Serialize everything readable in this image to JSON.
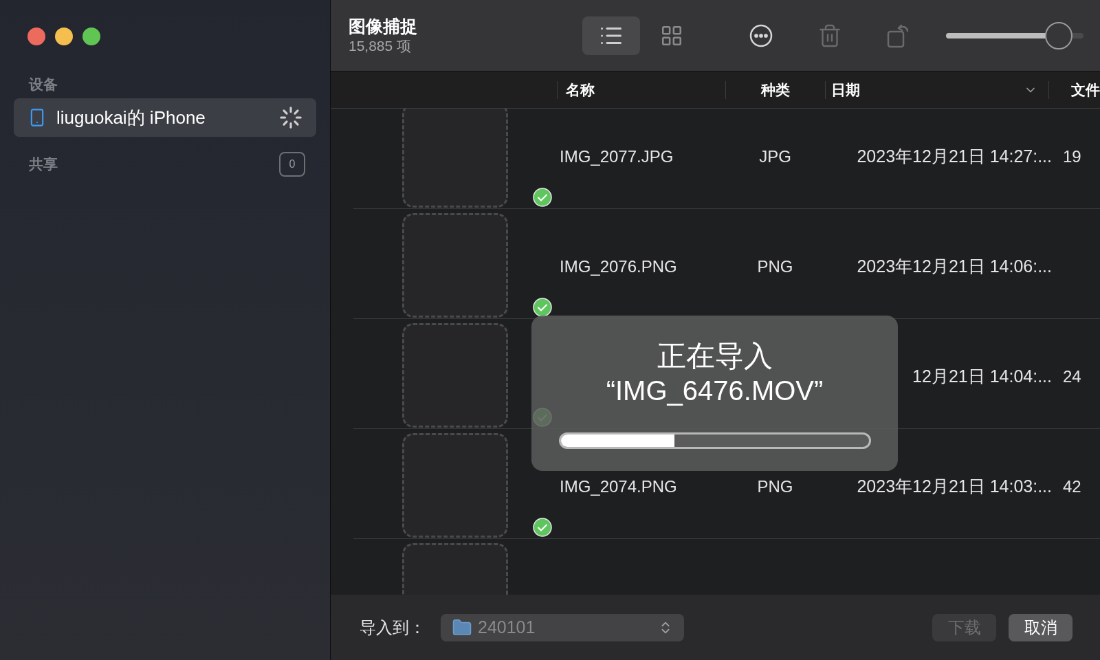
{
  "sidebar": {
    "sections": [
      {
        "heading": "设备",
        "items": [
          {
            "label": "liuguokai的 iPhone",
            "selected": true,
            "loading": true
          }
        ]
      },
      {
        "heading": "共享",
        "badge": "0"
      }
    ]
  },
  "toolbar": {
    "title": "图像捕捉",
    "subtitle": "15,885 项",
    "view_buttons": [
      {
        "kind": "list",
        "selected": true
      },
      {
        "kind": "grid",
        "selected": false
      }
    ],
    "actions": [
      {
        "kind": "more",
        "disabled": false
      },
      {
        "kind": "delete",
        "disabled": true
      },
      {
        "kind": "rotate",
        "disabled": true
      }
    ],
    "zoom_slider": {
      "level": 0.82
    }
  },
  "table": {
    "columns": [
      {
        "label": "名称",
        "sorted": false
      },
      {
        "label": "种类",
        "sorted": false
      },
      {
        "label": "日期",
        "sorted": true
      },
      {
        "label": "文件",
        "sorted": false
      }
    ],
    "rows": [
      {
        "name": "IMG_2077.JPG",
        "kind": "JPG",
        "date": "2023年12月21日 14:27:...",
        "size": "19",
        "imported": true
      },
      {
        "name": "IMG_2076.PNG",
        "kind": "PNG",
        "date": "2023年12月21日 14:06:...",
        "imported": true
      },
      {
        "date": "12月21日 14:04:...",
        "size": "24",
        "imported": true
      },
      {
        "name": "IMG_2074.PNG",
        "kind": "PNG",
        "date": "2023年12月21日 14:03:...",
        "size": "42",
        "imported": true
      }
    ]
  },
  "progress_dialog": {
    "title": "正在导入",
    "file": "“IMG_6476.MOV”",
    "level": 0.37
  },
  "bottom_bar": {
    "label": "导入到：",
    "destination": "240101",
    "buttons": [
      {
        "label": "下载",
        "disabled": true
      },
      {
        "label": "取消",
        "disabled": false
      }
    ]
  }
}
